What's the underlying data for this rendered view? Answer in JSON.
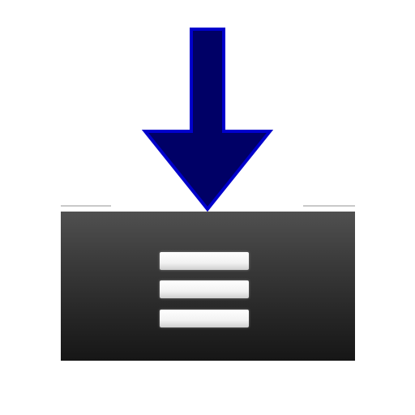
{
  "icons": {
    "arrow": "arrow-down-icon",
    "menu": "menu-icon"
  },
  "colors": {
    "arrow_fill": "#000066",
    "arrow_outline": "#0000cc",
    "bar_top": "#505050",
    "bar_bottom": "#161616",
    "menu_lines": "#ffffff"
  }
}
